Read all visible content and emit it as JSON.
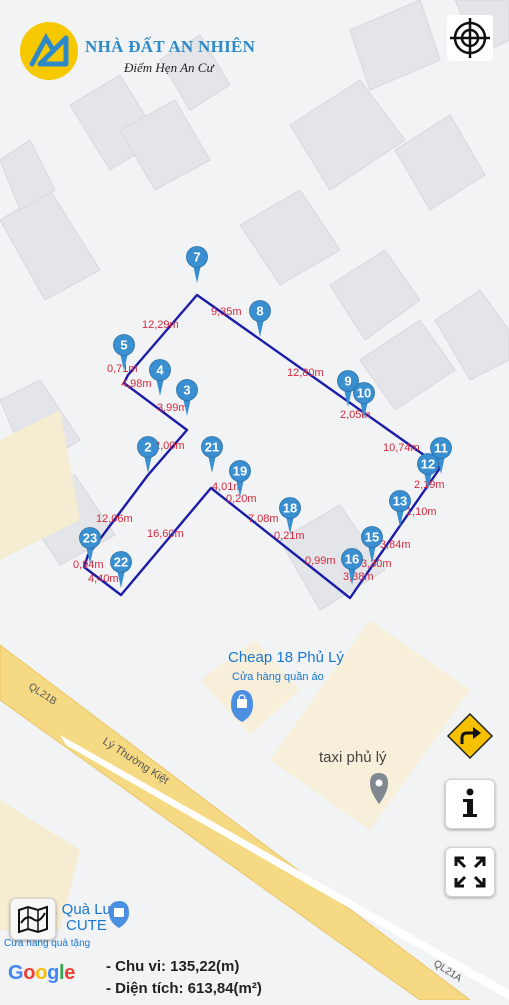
{
  "brand": {
    "name": "NHÀ ĐẤT AN NHIÊN",
    "slogan": "Điểm Hẹn An Cư",
    "logo_color": "#f5c800",
    "name_color": "#2e89c8"
  },
  "colors": {
    "boundary": "#1c1ca8",
    "marker": "#3a8fd0",
    "measurement": "#d6283e",
    "road": "#f5d97c"
  },
  "markers": [
    "2",
    "3",
    "4",
    "5",
    "7",
    "8",
    "9",
    "10",
    "11",
    "12",
    "13",
    "15",
    "16",
    "18",
    "19",
    "21",
    "22",
    "23"
  ],
  "measurements": [
    "12,29m",
    "9,35m",
    "0,71m",
    "4,98m",
    "3,99m",
    "12,80m",
    "2,05m",
    "10,74m",
    "2,00m",
    "4,01m",
    "0,20m",
    "2,19m",
    "1,10m",
    "12,06m",
    "16,60m",
    "7,08m",
    "0,21m",
    "0,99m",
    "3,84m",
    "3,30m",
    "3,38m",
    "0,94m",
    "4,40m"
  ],
  "roads": {
    "primary_left": "QL21B",
    "primary_right": "QL21A",
    "street": "Lý Thường Kiệt"
  },
  "pois": [
    {
      "name": "Cheap 18 Phủ Lý",
      "category": "Cửa hàng quần áo",
      "icon": "shopping-bag-icon"
    },
    {
      "name": "taxi phủ lý",
      "icon": "location-pin-icon"
    },
    {
      "name_partial": "S... Quà Lưu",
      "line2": "CUTE",
      "line3": "Cửa hàng quà tặng",
      "icon": "shopping-bag-icon"
    }
  ],
  "summary": {
    "perimeter": "- Chu vi: 135,22(m)",
    "area": "- Diện tích: 613,84(m²)"
  },
  "attribution": "Google",
  "buttons": {
    "locate": "crosshair-icon",
    "directions": "turn-right-icon",
    "info": "info-icon",
    "fullscreen": "expand-icon",
    "map_type": "map-layers-icon"
  }
}
